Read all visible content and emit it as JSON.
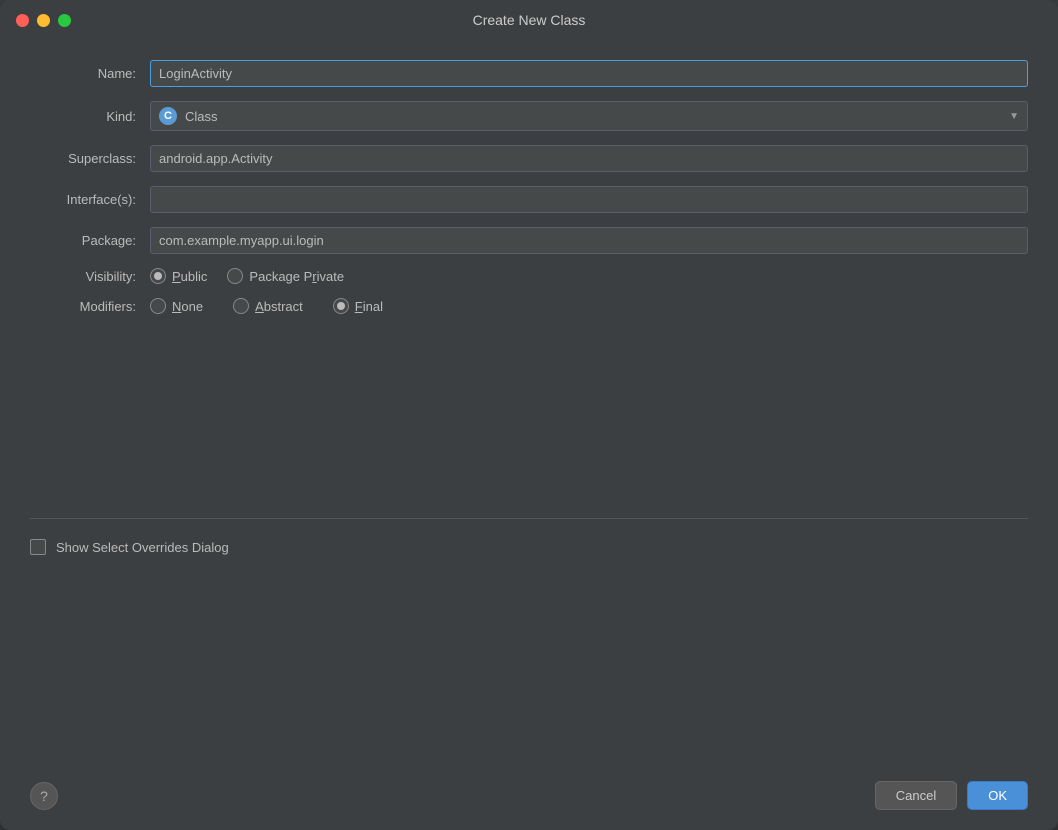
{
  "window": {
    "title": "Create New Class",
    "controls": {
      "close": "close",
      "minimize": "minimize",
      "maximize": "maximize"
    }
  },
  "form": {
    "name_label": "Name:",
    "name_value": "LoginActivity",
    "kind_label": "Kind:",
    "kind_value": "Class",
    "kind_icon": "C",
    "superclass_label": "Superclass:",
    "superclass_value": "android.app.Activity",
    "interfaces_label": "Interface(s):",
    "interfaces_value": "",
    "package_label": "Package:",
    "package_value": "com.example.myapp.ui.login",
    "visibility_label": "Visibility:",
    "visibility_options": [
      {
        "label": "Public",
        "underline": "u",
        "selected": true
      },
      {
        "label": "Package Private",
        "underline": "R",
        "selected": false
      }
    ],
    "modifiers_label": "Modifiers:",
    "modifiers_options": [
      {
        "label": "None",
        "underline": "N",
        "selected": false
      },
      {
        "label": "Abstract",
        "underline": "A",
        "selected": false
      },
      {
        "label": "Final",
        "underline": "F",
        "selected": true
      }
    ],
    "checkbox_label": "Show Select Overrides Dialog",
    "checkbox_checked": false
  },
  "footer": {
    "help_label": "?",
    "cancel_label": "Cancel",
    "ok_label": "OK"
  }
}
